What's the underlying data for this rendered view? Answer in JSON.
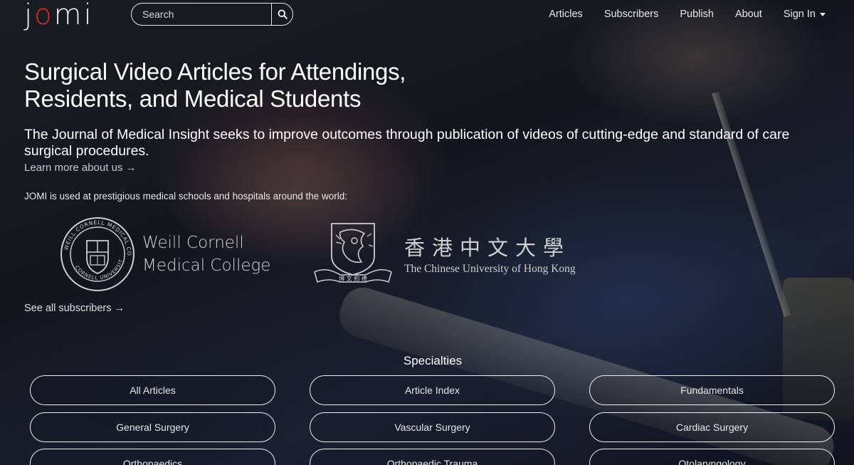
{
  "nav": {
    "logo_text": "JOMI",
    "search_placeholder": "Search",
    "links": [
      "Articles",
      "Subscribers",
      "Publish",
      "About"
    ],
    "sign_in": "Sign In"
  },
  "hero": {
    "title_line1": "Surgical Video Articles for Attendings,",
    "title_line2": "Residents, and Medical Students",
    "subtitle": "The Journal of Medical Insight seeks to improve outcomes through publication of videos of cutting-edge and standard of care surgical procedures.",
    "learn_more": "Learn more about us →",
    "used_at": "JOMI is used at prestigious medical schools and hospitals around the world:"
  },
  "subscribers": {
    "weill_line1": "Weill Cornell",
    "weill_line2": "Medical College",
    "weill_seal_text": "WEILL CORNELL MEDICAL COLLEGE · CORNELL UNIVERSITY",
    "cuhk_chinese": "香港中文大學",
    "cuhk_english": "The Chinese University of Hong Kong",
    "see_all": "See all subscribers →"
  },
  "specialties": {
    "heading": "Specialties",
    "items": [
      "All Articles",
      "Article Index",
      "Fundamentals",
      "General Surgery",
      "Vascular Surgery",
      "Cardiac Surgery",
      "Orthopaedics",
      "Orthopaedic Trauma",
      "Otolaryngology"
    ]
  },
  "colors": {
    "accent_logo": "#d62b2b",
    "text": "#ffffff",
    "button_border": "#f0f0f0"
  }
}
